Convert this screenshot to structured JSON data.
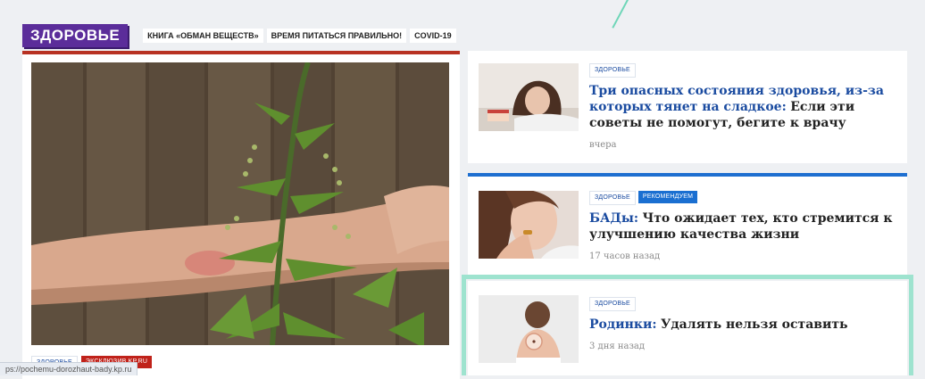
{
  "header": {
    "section_label": "ЗДОРОВЬЕ",
    "tags": [
      "КНИГА «ОБМАН ВЕЩЕСТВ»",
      "ВРЕМЯ ПИТАТЬСЯ ПРАВИЛЬНО!",
      "COVID-19"
    ]
  },
  "main_article": {
    "image_icon": "nettle-arm-photo",
    "badges": [
      "ЗДОРОВЬЕ",
      "ЭКСКЛЮЗИВ KP.RU"
    ]
  },
  "news": [
    {
      "image_icon": "woman-with-cake-photo",
      "badges": [
        "ЗДОРОВЬЕ"
      ],
      "lead": "Три опасных состояния здоровья, из-за которых тянет на сладкое:",
      "rest": "Если эти советы не помогут, бегите к врачу",
      "time": "вчера"
    },
    {
      "image_icon": "woman-with-capsule-photo",
      "badges": [
        "ЗДОРОВЬЕ",
        "РЕКОМЕНДУЕМ"
      ],
      "lead": "БАДы:",
      "rest": "Что ожидает тех, кто стремится к улучшению качества жизни",
      "time": "17 часов назад"
    },
    {
      "image_icon": "woman-back-moles-photo",
      "badges": [
        "ЗДОРОВЬЕ"
      ],
      "lead": "Родинки:",
      "rest": "Удалять нельзя оставить",
      "time": "3 дня назад"
    }
  ],
  "status_bar": {
    "url": "ps://pochemu-dorozhaut-bady.kp.ru"
  },
  "colors": {
    "section_purple": "#5b2d9a",
    "main_rule_red": "#b83223",
    "second_rule_blue": "#1e6fd0",
    "headline_blue": "#1a4ba0",
    "highlight_mint": "#9ee3cf"
  }
}
